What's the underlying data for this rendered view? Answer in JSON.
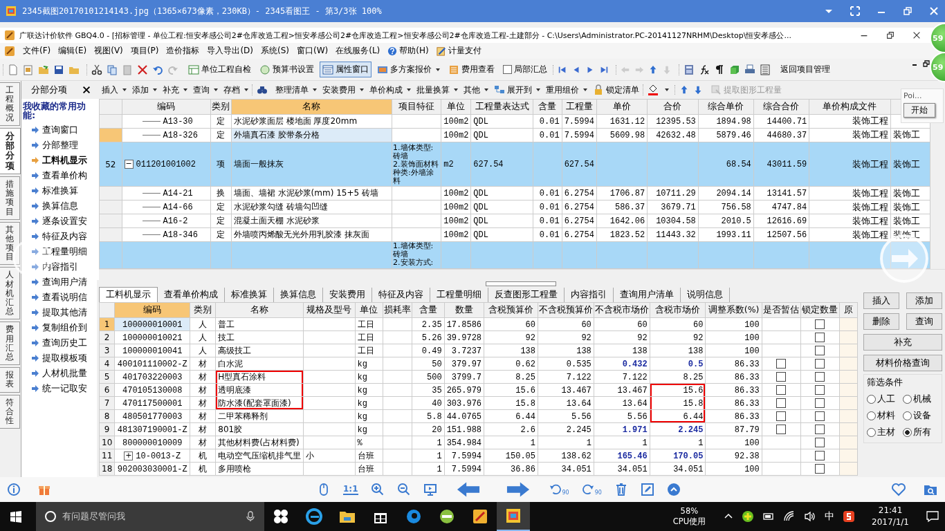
{
  "viewer": {
    "title": "2345截图20170101214143.jpg（1365×673像素，230KB）- 2345看图王 - 第3/3张 100%"
  },
  "app": {
    "title": "广联达计价软件 GBQ4.0 - [招标管理 - 单位工程:恒安孝感公司2#仓库改造工程>恒安孝感公司2#仓库改造工程>恒安孝感公司2#仓库改造工程-土建部分 - C:\\Users\\Administrator.PC-20141127NRHM\\Desktop\\恒安孝感公..."
  },
  "menu": [
    {
      "label": "文件(F)",
      "kind": "text"
    },
    {
      "label": "编辑(E)",
      "kind": "text"
    },
    {
      "label": "视图(V)",
      "kind": "text"
    },
    {
      "label": "项目(P)",
      "kind": "text"
    },
    {
      "label": "造价指标",
      "kind": "text"
    },
    {
      "label": "导入导出(D)",
      "kind": "text"
    },
    {
      "label": "系统(S)",
      "kind": "text"
    },
    {
      "label": "窗口(W)",
      "kind": "text"
    },
    {
      "label": "在线服务(L)",
      "kind": "text"
    },
    {
      "label": "帮助(H)",
      "kind": "help"
    },
    {
      "label": "计量支付",
      "kind": "pay"
    }
  ],
  "toolbar": [
    {
      "kind": "file-icons"
    },
    {
      "kind": "edit-icons"
    },
    {
      "kind": "button",
      "label": "单位工程自检",
      "selected": false
    },
    {
      "kind": "button",
      "label": "预算书设置",
      "selected": false
    },
    {
      "kind": "button",
      "label": "属性窗口",
      "selected": true
    },
    {
      "kind": "dropdown",
      "label": "多方案报价",
      "selected": false
    },
    {
      "kind": "button",
      "label": "费用查看",
      "selected": false
    },
    {
      "kind": "check",
      "label": "局部汇总",
      "checked": false
    },
    {
      "kind": "nav-icons"
    },
    {
      "kind": "move-icons"
    },
    {
      "kind": "tool-icons"
    },
    {
      "kind": "button",
      "label": "返回项目管理",
      "selected": false
    }
  ],
  "toolbar2": [
    {
      "kind": "dropdown",
      "label": "插入",
      "disabled": false
    },
    {
      "kind": "dropdown",
      "label": "添加",
      "disabled": false
    },
    {
      "kind": "dropdown",
      "label": "补充",
      "disabled": false
    },
    {
      "kind": "dropdown",
      "label": "查询",
      "disabled": false
    },
    {
      "kind": "dropdown",
      "label": "存档",
      "disabled": false
    },
    {
      "kind": "find-icon"
    },
    {
      "kind": "dropdown",
      "label": "整理清单",
      "disabled": false
    },
    {
      "kind": "dropdown",
      "label": "安装费用",
      "disabled": false
    },
    {
      "kind": "dropdown",
      "label": "单价构成",
      "disabled": false
    },
    {
      "kind": "dropdown",
      "label": "批量换算",
      "disabled": false
    },
    {
      "kind": "dropdown",
      "label": "其他",
      "disabled": false
    },
    {
      "kind": "expand",
      "label": "展开到",
      "disabled": false
    },
    {
      "kind": "dropdown",
      "label": "重用组价",
      "disabled": false
    },
    {
      "kind": "lock",
      "label": "锁定清单",
      "disabled": false
    },
    {
      "kind": "paint-icon"
    },
    {
      "kind": "arrow-icons"
    },
    {
      "kind": "extract",
      "label": "提取图形工程量",
      "disabled": true
    }
  ],
  "vertical_tabs": [
    {
      "label": "工程概况",
      "selected": false
    },
    {
      "label": "分部分项",
      "selected": true
    },
    {
      "label": "措施项目",
      "selected": false
    },
    {
      "label": "其他项目",
      "selected": false
    },
    {
      "label": "人材机汇总",
      "selected": false
    },
    {
      "label": "费用汇总",
      "selected": false
    },
    {
      "label": "报表",
      "selected": false
    },
    {
      "label": "符合性",
      "selected": false
    }
  ],
  "sidebar": {
    "header": "分部分项",
    "heading": "我收藏的常用功能:",
    "items": [
      {
        "label": "查询窗口",
        "selected": false
      },
      {
        "label": "分部整理",
        "selected": false
      },
      {
        "label": "工料机显示",
        "selected": true
      },
      {
        "label": "查看单价构",
        "selected": false
      },
      {
        "label": "标准换算",
        "selected": false
      },
      {
        "label": "换算信息",
        "selected": false
      },
      {
        "label": "逐条设置安",
        "selected": false
      },
      {
        "label": "特征及内容",
        "selected": false
      },
      {
        "label": "工程量明细",
        "selected": false
      },
      {
        "label": "内容指引",
        "selected": false
      },
      {
        "label": "查询用户清",
        "selected": false
      },
      {
        "label": "查看说明信",
        "selected": false
      },
      {
        "label": "提取其他清",
        "selected": false
      },
      {
        "label": "复制组价到",
        "selected": false
      },
      {
        "label": "查询历史工",
        "selected": false
      },
      {
        "label": "提取模板项",
        "selected": false
      },
      {
        "label": "人材机批量",
        "selected": false
      },
      {
        "label": "统一记取安",
        "selected": false
      }
    ]
  },
  "upper_grid": {
    "columns": [
      {
        "label": "编码",
        "selected": false
      },
      {
        "label": "类别",
        "selected": false
      },
      {
        "label": "名称",
        "selected": true
      },
      {
        "label": "项目特征",
        "selected": false
      },
      {
        "label": "单位",
        "selected": false
      },
      {
        "label": "工程量表达式",
        "selected": false
      },
      {
        "label": "含量",
        "selected": false
      },
      {
        "label": "工程量",
        "selected": false
      },
      {
        "label": "单价",
        "selected": false
      },
      {
        "label": "合价",
        "selected": false
      },
      {
        "label": "综合单价",
        "selected": false
      },
      {
        "label": "综合合价",
        "selected": false
      },
      {
        "label": "单价构成文件",
        "selected": false
      }
    ],
    "rows": [
      {
        "kind": "sub",
        "selected": false,
        "code": "A13-30",
        "type": "定",
        "name": "水泥砂浆面层 楼地面 厚度20mm",
        "unit": "100m2",
        "expr": "QDL",
        "content": "0.01",
        "qty": "7.5994",
        "price": "1631.12",
        "total": "12395.53",
        "cprice": "1894.98",
        "ctotal": "14400.71",
        "file": "装饰工程"
      },
      {
        "kind": "sub",
        "selected": true,
        "code": "A18-326",
        "type": "定",
        "name": "外墙真石漆 胶带条分格",
        "unit": "100m2",
        "expr": "QDL",
        "content": "0.01",
        "qty": "7.5994",
        "price": "5609.98",
        "total": "42632.48",
        "cprice": "5879.46",
        "ctotal": "44680.37",
        "file": "装饰工程",
        "file2": "装饰工"
      },
      {
        "kind": "item",
        "selected": false,
        "num": "52",
        "toggle": "−",
        "code": "011201001002",
        "type": "项",
        "name": "墙面一般抹灰",
        "feature": [
          "1.墙体类型:",
          "砖墙",
          "2.装饰面材料",
          "种类:外墙涂",
          "料"
        ],
        "unit": "m2",
        "expr": "627.54",
        "qty": "627.54",
        "cprice": "68.54",
        "ctotal": "43011.59",
        "file": "装饰工程",
        "file2": "装饰工"
      },
      {
        "kind": "sub",
        "selected": false,
        "code": "A14-21",
        "type": "换",
        "name": "墙面、墙裙 水泥砂浆(mm) 15+5 砖墙",
        "unit": "100m2",
        "expr": "QDL",
        "content": "0.01",
        "qty": "6.2754",
        "price": "1706.87",
        "total": "10711.29",
        "cprice": "2094.14",
        "ctotal": "13141.57",
        "file": "装饰工程",
        "file2": "装饰工"
      },
      {
        "kind": "sub",
        "selected": false,
        "code": "A14-66",
        "type": "定",
        "name": "水泥砂浆勾缝 砖墙勾凹缝",
        "unit": "100m2",
        "expr": "QDL",
        "content": "0.01",
        "qty": "6.2754",
        "price": "586.37",
        "total": "3679.71",
        "cprice": "756.58",
        "ctotal": "4747.84",
        "file": "装饰工程",
        "file2": "装饰工"
      },
      {
        "kind": "sub",
        "selected": false,
        "code": "A16-2",
        "type": "定",
        "name": "混凝土面天棚 水泥砂浆",
        "unit": "100m2",
        "expr": "QDL",
        "content": "0.01",
        "qty": "6.2754",
        "price": "1642.06",
        "total": "10304.58",
        "cprice": "2010.5",
        "ctotal": "12616.69",
        "file": "装饰工程",
        "file2": "装饰工"
      },
      {
        "kind": "sub",
        "selected": false,
        "code": "A18-346",
        "type": "定",
        "name": "外墙喷丙烯酸无光外用乳胶漆 抹灰面",
        "unit": "100m2",
        "expr": "QDL",
        "content": "0.01",
        "qty": "6.2754",
        "price": "1823.52",
        "total": "11443.32",
        "cprice": "1993.11",
        "ctotal": "12507.56",
        "file": "装饰工程",
        "file2": "装饰工"
      },
      {
        "kind": "item",
        "selected": false,
        "feature": [
          "1.墙体类型:",
          "砖墙",
          "2.安装方式:"
        ]
      }
    ]
  },
  "bottom_tabs": [
    {
      "label": "工料机显示",
      "selected": true
    },
    {
      "label": "查看单价构成",
      "selected": false
    },
    {
      "label": "标准换算",
      "selected": false
    },
    {
      "label": "换算信息",
      "selected": false
    },
    {
      "label": "安装费用",
      "selected": false
    },
    {
      "label": "特征及内容",
      "selected": false
    },
    {
      "label": "工程量明细",
      "selected": false
    },
    {
      "label": "反查图形工程量",
      "selected": false
    },
    {
      "label": "内容指引",
      "selected": false
    },
    {
      "label": "查询用户清单",
      "selected": false
    },
    {
      "label": "说明信息",
      "selected": false
    }
  ],
  "lower_grid": {
    "columns": [
      {
        "label": "编码",
        "selected": true
      },
      {
        "label": "类别",
        "selected": false
      },
      {
        "label": "名称",
        "selected": false
      },
      {
        "label": "规格及型号",
        "selected": false
      },
      {
        "label": "单位",
        "selected": false
      },
      {
        "label": "损耗率",
        "selected": false
      },
      {
        "label": "含量",
        "selected": false
      },
      {
        "label": "数量",
        "selected": false
      },
      {
        "label": "含税预算价",
        "selected": false
      },
      {
        "label": "不含税预算价",
        "selected": false
      },
      {
        "label": "不含税市场价",
        "selected": false
      },
      {
        "label": "含税市场价",
        "selected": false
      },
      {
        "label": "调整系数(%)",
        "selected": false
      },
      {
        "label": "是否暂估",
        "selected": false
      },
      {
        "label": "锁定数量",
        "selected": false
      },
      {
        "label": "原",
        "selected": false
      }
    ],
    "rows": [
      {
        "num": "1",
        "selected": true,
        "code": "100000010001",
        "type": "人",
        "name": "普工",
        "unit": "工日",
        "content": "2.35",
        "qty": "17.8586",
        "tb": "60",
        "nb": "60",
        "nm": "60",
        "tm": "60",
        "coef": "100",
        "adjusted": false,
        "locked": false,
        "boxed_name": false,
        "boxed_price": false
      },
      {
        "num": "2",
        "selected": false,
        "code": "100000010021",
        "type": "人",
        "name": "技工",
        "unit": "工日",
        "content": "5.26",
        "qty": "39.9728",
        "tb": "92",
        "nb": "92",
        "nm": "92",
        "tm": "92",
        "coef": "100",
        "adjusted": false,
        "locked": false,
        "boxed_name": false,
        "boxed_price": false
      },
      {
        "num": "3",
        "selected": false,
        "code": "100000010041",
        "type": "人",
        "name": "高级技工",
        "unit": "工日",
        "content": "0.49",
        "qty": "3.7237",
        "tb": "138",
        "nb": "138",
        "nm": "138",
        "tm": "138",
        "coef": "100",
        "adjusted": false,
        "locked": false,
        "boxed_name": false,
        "boxed_price": false
      },
      {
        "num": "4",
        "selected": false,
        "code": "400101110002-Z",
        "type": "材",
        "name": "白水泥",
        "unit": "kg",
        "content": "50",
        "qty": "379.97",
        "tb": "0.62",
        "nb": "0.535",
        "nm": "0.432",
        "tm": "0.5",
        "coef": "86.33",
        "adjusted": true,
        "estimate": false,
        "locked": false,
        "boxed_name": false,
        "boxed_price": false
      },
      {
        "num": "5",
        "selected": false,
        "code": "401703220003",
        "type": "材",
        "name": "H型真石涂料",
        "unit": "kg",
        "content": "500",
        "qty": "3799.7",
        "tb": "8.25",
        "nb": "7.122",
        "nm": "7.122",
        "tm": "8.25",
        "coef": "86.33",
        "adjusted": false,
        "estimate": false,
        "locked": false,
        "boxed_name": true,
        "boxed_price": false
      },
      {
        "num": "6",
        "selected": false,
        "code": "470105130008",
        "type": "材",
        "name": "透明底漆",
        "unit": "kg",
        "content": "35",
        "qty": "265.979",
        "tb": "15.6",
        "nb": "13.467",
        "nm": "13.467",
        "tm": "15.6",
        "coef": "86.33",
        "adjusted": false,
        "estimate": false,
        "locked": false,
        "boxed_name": true,
        "boxed_price": true
      },
      {
        "num": "7",
        "selected": false,
        "code": "470117500001",
        "type": "材",
        "name": "防水漆(配套罩面漆)",
        "unit": "kg",
        "content": "40",
        "qty": "303.976",
        "tb": "15.8",
        "nb": "13.64",
        "nm": "13.64",
        "tm": "15.8",
        "coef": "86.33",
        "adjusted": false,
        "estimate": false,
        "locked": false,
        "boxed_name": true,
        "boxed_price": true
      },
      {
        "num": "8",
        "selected": false,
        "code": "480501770003",
        "type": "材",
        "name": "二甲苯稀释剂",
        "unit": "kg",
        "content": "5.8",
        "qty": "44.0765",
        "tb": "6.44",
        "nb": "5.56",
        "nm": "5.56",
        "tm": "6.44",
        "coef": "86.33",
        "adjusted": false,
        "estimate": false,
        "locked": false,
        "boxed_name": false,
        "boxed_price": true
      },
      {
        "num": "9",
        "selected": false,
        "code": "481307190001-Z",
        "type": "材",
        "name": "801胶",
        "unit": "kg",
        "content": "20",
        "qty": "151.988",
        "tb": "2.6",
        "nb": "2.245",
        "nm": "1.971",
        "tm": "2.245",
        "coef": "87.79",
        "adjusted": true,
        "estimate": false,
        "locked": false,
        "boxed_name": false,
        "boxed_price": false
      },
      {
        "num": "10",
        "selected": false,
        "code": "800000010009",
        "type": "材",
        "name": "其他材料费(占材料费)",
        "unit": "%",
        "content": "1",
        "qty": "354.984",
        "tb": "1",
        "nb": "1",
        "nm": "1",
        "tm": "1",
        "coef": "100",
        "adjusted": false,
        "locked": false,
        "boxed_name": false,
        "boxed_price": false
      },
      {
        "num": "11",
        "selected": false,
        "toggle": "+",
        "code": "10-0013-Z",
        "type": "机",
        "name": "电动空气压缩机排气里",
        "spec": "小",
        "unit": "台班",
        "content": "1",
        "qty": "7.5994",
        "tb": "150.05",
        "nb": "138.62",
        "nm": "165.46",
        "tm": "170.05",
        "coef": "92.38",
        "adjusted": true,
        "locked": false,
        "boxed_name": false,
        "boxed_price": false
      },
      {
        "num": "18",
        "selected": false,
        "code": "902003030001-Z",
        "type": "机",
        "name": "多用喷枪",
        "unit": "台班",
        "content": "1",
        "qty": "7.5994",
        "tb": "36.86",
        "nb": "34.051",
        "nm": "34.051",
        "tm": "34.051",
        "coef": "100",
        "adjusted": false,
        "locked": false,
        "boxed_name": false,
        "boxed_price": false
      }
    ]
  },
  "side_buttons": [
    {
      "label": "插入",
      "wide": false
    },
    {
      "label": "添加",
      "wide": false
    },
    {
      "label": "删除",
      "wide": false
    },
    {
      "label": "查询",
      "wide": false
    },
    {
      "label": "补充",
      "wide": true
    },
    {
      "label": "材料价格查询",
      "wide": true
    }
  ],
  "filter": {
    "title": "筛选条件",
    "options": [
      {
        "label": "人工",
        "selected": false
      },
      {
        "label": "机械",
        "selected": false
      },
      {
        "label": "材料",
        "selected": false
      },
      {
        "label": "设备",
        "selected": false
      },
      {
        "label": "主材",
        "selected": false
      },
      {
        "label": "所有",
        "selected": true
      }
    ]
  },
  "floating": {
    "badges": [
      "59",
      "59"
    ],
    "popup": {
      "title": "Poi...",
      "button": "开始"
    }
  },
  "viewer_bar": {
    "scale": "1:1",
    "rotate": [
      "90",
      "90"
    ]
  },
  "taskbar": {
    "search": {
      "placeholder": "有问题尽管问我"
    },
    "apps": [
      {
        "kind": "fan",
        "selected": false
      },
      {
        "kind": "browser",
        "selected": false
      },
      {
        "kind": "folder",
        "selected": false
      },
      {
        "kind": "store",
        "selected": false
      },
      {
        "kind": "swirl",
        "selected": false
      },
      {
        "kind": "globe",
        "selected": false
      },
      {
        "kind": "notes",
        "selected": false
      },
      {
        "kind": "viewer",
        "selected": true
      }
    ],
    "cpu": "58%",
    "cpu_label": "CPU使用",
    "ime": "中",
    "time": "21:41",
    "date": "2017/1/1"
  }
}
